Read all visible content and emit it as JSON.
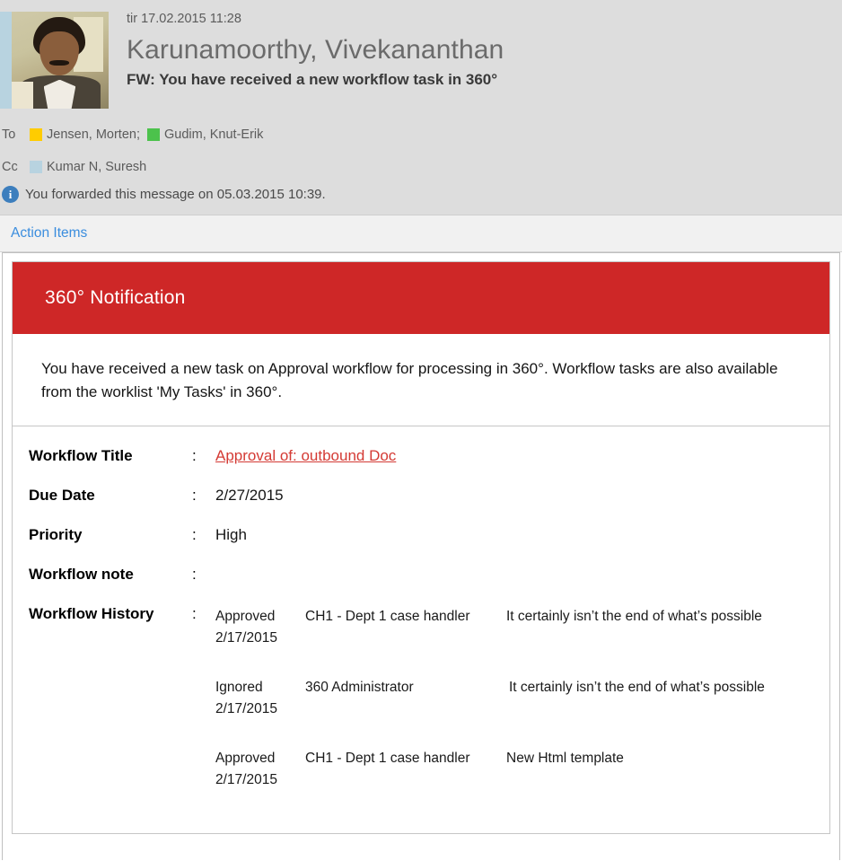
{
  "header": {
    "date": "tir 17.02.2015 11:28",
    "sender": "Karunamoorthy, Vivekananthan",
    "subject": "FW: You have received a new workflow task in 360°",
    "to_label": "To",
    "cc_label": "Cc",
    "to_recipients": [
      {
        "name": "Jensen, Morten;",
        "presence_color": "#ffcc00"
      },
      {
        "name": "Gudim, Knut-Erik",
        "presence_color": "#4cc24c"
      }
    ],
    "cc_recipients": [
      {
        "name": "Kumar N, Suresh",
        "presence_color": "#b8d3e0"
      }
    ],
    "forward_note": "You forwarded this message on 05.03.2015 10:39.",
    "info_icon_glyph": "i",
    "avatar_alt": "sender-photo"
  },
  "action_bar": {
    "label": "Action Items"
  },
  "notification": {
    "banner_title": "360° Notification",
    "banner_color": "#ce2727",
    "intro": "You have received a new task on Approval workflow for processing in 360°. Workflow tasks are also available from the worklist 'My Tasks' in 360°.",
    "colon": ":",
    "fields": [
      {
        "label": "Workflow Title",
        "value": "Approval of: outbound Doc",
        "is_link": true,
        "link_color": "#d43a34"
      },
      {
        "label": "Due Date",
        "value": "2/27/2015",
        "is_link": false
      },
      {
        "label": "Priority",
        "value": "High",
        "is_link": false
      },
      {
        "label": "Workflow note",
        "value": "",
        "is_link": false
      }
    ],
    "history_label": "Workflow History",
    "history": [
      {
        "status": "Approved",
        "date": "2/17/2015",
        "actor": "CH1 - Dept 1 case handler",
        "comment": "It certainly isn’t the end of what’s possible"
      },
      {
        "status": "Ignored",
        "date": "2/17/2015",
        "actor": "360 Administrator",
        "comment": "It certainly isn’t the end of what’s possible"
      },
      {
        "status": "Approved",
        "date": "2/17/2015",
        "actor": "CH1 - Dept 1 case handler",
        "comment": "New Html template"
      }
    ]
  }
}
